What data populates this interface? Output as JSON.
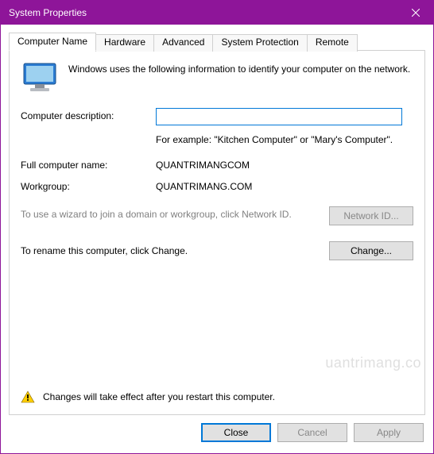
{
  "window": {
    "title": "System Properties"
  },
  "tabs": {
    "computer_name": "Computer Name",
    "hardware": "Hardware",
    "advanced": "Advanced",
    "system_protection": "System Protection",
    "remote": "Remote"
  },
  "panel": {
    "intro": "Windows uses the following information to identify your computer on the network.",
    "description_label": "Computer description:",
    "description_value": "",
    "description_example": "For example: \"Kitchen Computer\" or \"Mary's Computer\".",
    "full_name_label": "Full computer name:",
    "full_name_value": "QUANTRIMANGCOM",
    "workgroup_label": "Workgroup:",
    "workgroup_value": "QUANTRIMANG.COM",
    "wizard_text": "To use a wizard to join a domain or workgroup, click Network ID.",
    "network_id_button": "Network ID...",
    "rename_text": "To rename this computer, click Change.",
    "change_button": "Change...",
    "warning_text": "Changes will take effect after you restart this computer."
  },
  "buttons": {
    "close": "Close",
    "cancel": "Cancel",
    "apply": "Apply"
  },
  "watermark": "uantrimang.co"
}
